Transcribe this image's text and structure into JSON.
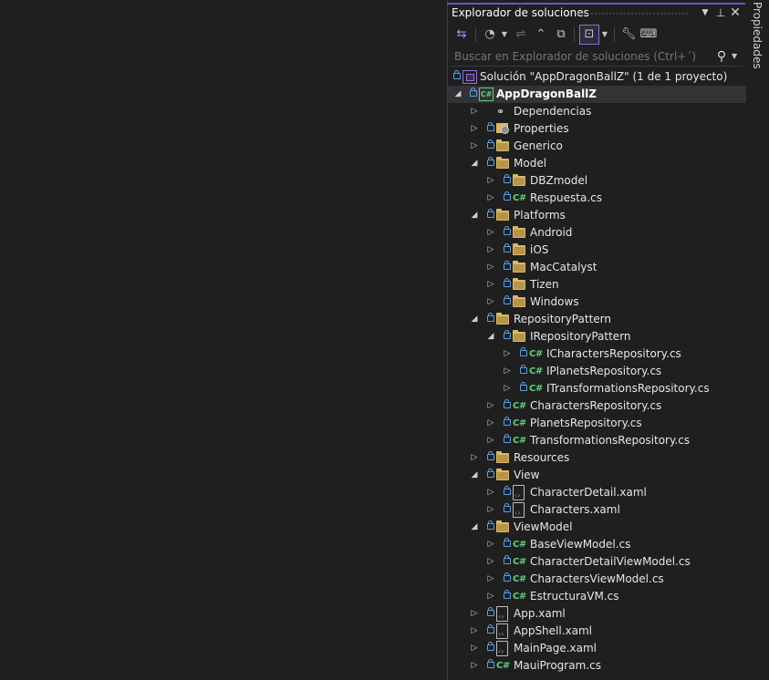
{
  "panel": {
    "title": "Explorador de soluciones"
  },
  "search": {
    "placeholder": "Buscar en Explorador de soluciones (Ctrl+´)"
  },
  "side_tab": {
    "label": "Propiedades"
  },
  "solution": {
    "label": "Solución \"AppDragonBallZ\"  (1 de 1 proyecto)"
  },
  "project": {
    "label": "AppDragonBallZ"
  },
  "tree": [
    {
      "label": "Dependencias",
      "icon": "dependencies-icon",
      "level": 1,
      "expander": "collapsed",
      "lock": false
    },
    {
      "label": "Properties",
      "icon": "properties-icon",
      "level": 1,
      "expander": "collapsed",
      "lock": true
    },
    {
      "label": "Generico",
      "icon": "folder-icon",
      "level": 1,
      "expander": "collapsed",
      "lock": true
    },
    {
      "label": "Model",
      "icon": "folder-icon",
      "level": 1,
      "expander": "expanded",
      "lock": true
    },
    {
      "label": "DBZmodel",
      "icon": "folder-icon",
      "level": 2,
      "expander": "collapsed",
      "lock": true
    },
    {
      "label": "Respuesta.cs",
      "icon": "csharp-file-icon",
      "level": 2,
      "expander": "collapsed",
      "lock": true
    },
    {
      "label": "Platforms",
      "icon": "folder-icon",
      "level": 1,
      "expander": "expanded",
      "lock": true
    },
    {
      "label": "Android",
      "icon": "folder-icon",
      "level": 2,
      "expander": "collapsed",
      "lock": true
    },
    {
      "label": "iOS",
      "icon": "folder-icon",
      "level": 2,
      "expander": "collapsed",
      "lock": true
    },
    {
      "label": "MacCatalyst",
      "icon": "folder-icon",
      "level": 2,
      "expander": "collapsed",
      "lock": true
    },
    {
      "label": "Tizen",
      "icon": "folder-icon",
      "level": 2,
      "expander": "collapsed",
      "lock": true
    },
    {
      "label": "Windows",
      "icon": "folder-icon",
      "level": 2,
      "expander": "collapsed",
      "lock": true
    },
    {
      "label": "RepositoryPattern",
      "icon": "folder-icon",
      "level": 1,
      "expander": "expanded",
      "lock": true
    },
    {
      "label": "IRepositoryPattern",
      "icon": "folder-icon",
      "level": 2,
      "expander": "expanded",
      "lock": true
    },
    {
      "label": "ICharactersRepository.cs",
      "icon": "csharp-file-icon",
      "level": 3,
      "expander": "collapsed",
      "lock": true
    },
    {
      "label": "IPlanetsRepository.cs",
      "icon": "csharp-file-icon",
      "level": 3,
      "expander": "collapsed",
      "lock": true
    },
    {
      "label": "ITransformationsRepository.cs",
      "icon": "csharp-file-icon",
      "level": 3,
      "expander": "collapsed",
      "lock": true
    },
    {
      "label": "CharactersRepository.cs",
      "icon": "csharp-file-icon",
      "level": 2,
      "expander": "collapsed",
      "lock": true
    },
    {
      "label": "PlanetsRepository.cs",
      "icon": "csharp-file-icon",
      "level": 2,
      "expander": "collapsed",
      "lock": true
    },
    {
      "label": "TransformationsRepository.cs",
      "icon": "csharp-file-icon",
      "level": 2,
      "expander": "collapsed",
      "lock": true
    },
    {
      "label": "Resources",
      "icon": "folder-icon",
      "level": 1,
      "expander": "collapsed",
      "lock": true
    },
    {
      "label": "View",
      "icon": "folder-icon",
      "level": 1,
      "expander": "expanded",
      "lock": true
    },
    {
      "label": "CharacterDetail.xaml",
      "icon": "xaml-file-icon",
      "level": 2,
      "expander": "collapsed",
      "lock": true
    },
    {
      "label": "Characters.xaml",
      "icon": "xaml-file-icon",
      "level": 2,
      "expander": "collapsed",
      "lock": true
    },
    {
      "label": "ViewModel",
      "icon": "folder-icon",
      "level": 1,
      "expander": "expanded",
      "lock": true
    },
    {
      "label": "BaseViewModel.cs",
      "icon": "csharp-file-icon",
      "level": 2,
      "expander": "collapsed",
      "lock": true
    },
    {
      "label": "CharacterDetailViewModel.cs",
      "icon": "csharp-file-icon",
      "level": 2,
      "expander": "collapsed",
      "lock": true
    },
    {
      "label": "CharactersViewModel.cs",
      "icon": "csharp-file-icon",
      "level": 2,
      "expander": "collapsed",
      "lock": true
    },
    {
      "label": "EstructuraVM.cs",
      "icon": "csharp-file-icon",
      "level": 2,
      "expander": "collapsed",
      "lock": true
    },
    {
      "label": "App.xaml",
      "icon": "xaml-file-icon",
      "level": 1,
      "expander": "collapsed",
      "lock": true
    },
    {
      "label": "AppShell.xaml",
      "icon": "xaml-file-icon",
      "level": 1,
      "expander": "collapsed",
      "lock": true
    },
    {
      "label": "MainPage.xaml",
      "icon": "xaml-file-icon",
      "level": 1,
      "expander": "collapsed",
      "lock": true
    },
    {
      "label": "MauiProgram.cs",
      "icon": "csharp-file-icon",
      "level": 1,
      "expander": "collapsed",
      "lock": true
    }
  ]
}
